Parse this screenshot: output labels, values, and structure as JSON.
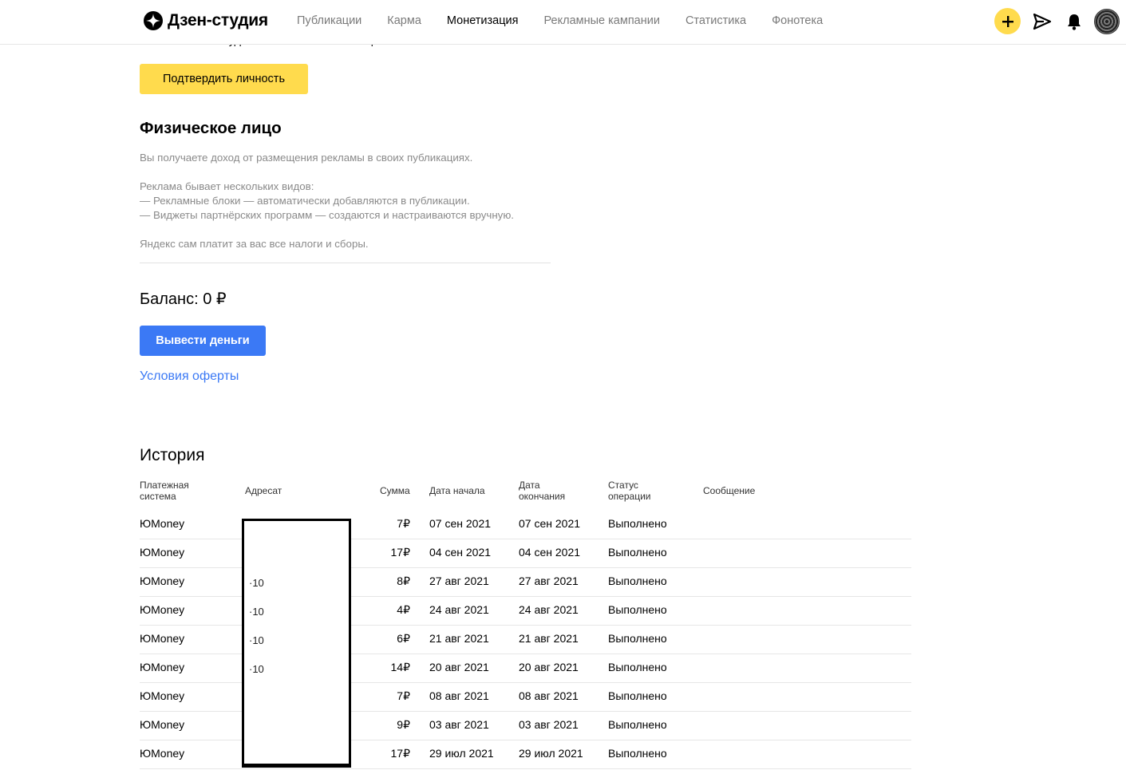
{
  "header": {
    "logo_text": "Дзен-студия",
    "nav": [
      "Публикации",
      "Карма",
      "Монетизация",
      "Рекламные кампании",
      "Статистика",
      "Фонотека"
    ],
    "active_nav": "Монетизация",
    "icons": [
      "plus-icon",
      "send-icon",
      "bell-icon",
      "avatar"
    ],
    "accent_color": "#ffdb4d"
  },
  "top": {
    "cutoff_text": "вашего канала будет отключена монетизация.",
    "verify_button": "Подтвердить личность"
  },
  "individual": {
    "title": "Физическое лицо",
    "lines": [
      "Вы получаете доход от размещения рекламы в своих публикациях.",
      "Реклама бывает нескольких видов:",
      "— Рекламные блоки — автоматически добавляются в публикации.",
      "— Виджеты партнёрских программ — создаются и настраиваются вручную.",
      "Яндекс сам платит за вас все налоги и сборы."
    ]
  },
  "balance": {
    "label": "Баланс: 0 ₽",
    "withdraw_button": "Вывести деньги",
    "offer_link": "Условия оферты",
    "button_color": "#3b79f5"
  },
  "history": {
    "title": "История",
    "columns": {
      "system": "Платежная система",
      "address": "Адресат",
      "sum": "Сумма",
      "start": "Дата начала",
      "end": "Дата окончания",
      "status": "Статус операции",
      "message": "Сообщение"
    },
    "rows": [
      {
        "system": "ЮMoney",
        "sum": "7₽",
        "start": "07 сен 2021",
        "end": "07 сен 2021",
        "status": "Выполнено"
      },
      {
        "system": "ЮMoney",
        "sum": "17₽",
        "start": "04 сен 2021",
        "end": "04 сен 2021",
        "status": "Выполнено"
      },
      {
        "system": "ЮMoney",
        "sum": "8₽",
        "start": "27 авг 2021",
        "end": "27 авг 2021",
        "status": "Выполнено"
      },
      {
        "system": "ЮMoney",
        "sum": "4₽",
        "start": "24 авг 2021",
        "end": "24 авг 2021",
        "status": "Выполнено"
      },
      {
        "system": "ЮMoney",
        "sum": "6₽",
        "start": "21 авг 2021",
        "end": "21 авг 2021",
        "status": "Выполнено"
      },
      {
        "system": "ЮMoney",
        "sum": "14₽",
        "start": "20 авг 2021",
        "end": "20 авг 2021",
        "status": "Выполнено"
      },
      {
        "system": "ЮMoney",
        "sum": "7₽",
        "start": "08 авг 2021",
        "end": "08 авг 2021",
        "status": "Выполнено"
      },
      {
        "system": "ЮMoney",
        "sum": "9₽",
        "start": "03 авг 2021",
        "end": "03 авг 2021",
        "status": "Выполнено"
      },
      {
        "system": "ЮMoney",
        "sum": "17₽",
        "start": "29 июл 2021",
        "end": "29 июл 2021",
        "status": "Выполнено"
      }
    ]
  }
}
